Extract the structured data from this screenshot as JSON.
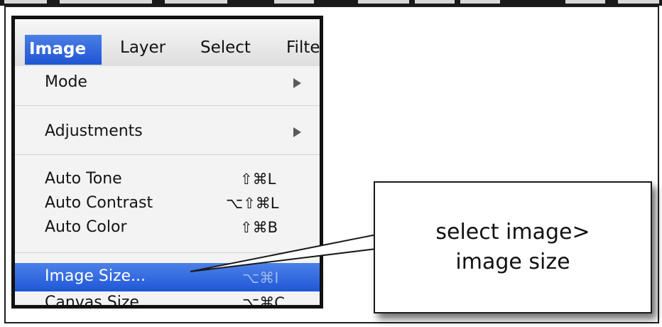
{
  "menubar": {
    "items": [
      {
        "label": "Image"
      },
      {
        "label": "Layer"
      },
      {
        "label": "Select"
      },
      {
        "label": "Filte"
      }
    ]
  },
  "menu": {
    "items": [
      {
        "label": "Mode",
        "shortcut": "",
        "submenu": true
      },
      {
        "label": "Adjustments",
        "shortcut": "",
        "submenu": true
      },
      {
        "label": "Auto Tone",
        "shortcut": "⇧⌘L"
      },
      {
        "label": "Auto Contrast",
        "shortcut": "⌥⇧⌘L"
      },
      {
        "label": "Auto Color",
        "shortcut": "⇧⌘B"
      },
      {
        "label": "Image Size...",
        "shortcut": "⌥⌘I",
        "highlighted": true
      },
      {
        "label": "Canvas Size...",
        "shortcut": "⌥⌘C"
      }
    ]
  },
  "callout": {
    "text": "select image>\nimage size"
  },
  "colors": {
    "highlight": "#2a62dc",
    "frame": "#111111"
  },
  "icons": {
    "submenu": "triangle-right-icon"
  }
}
